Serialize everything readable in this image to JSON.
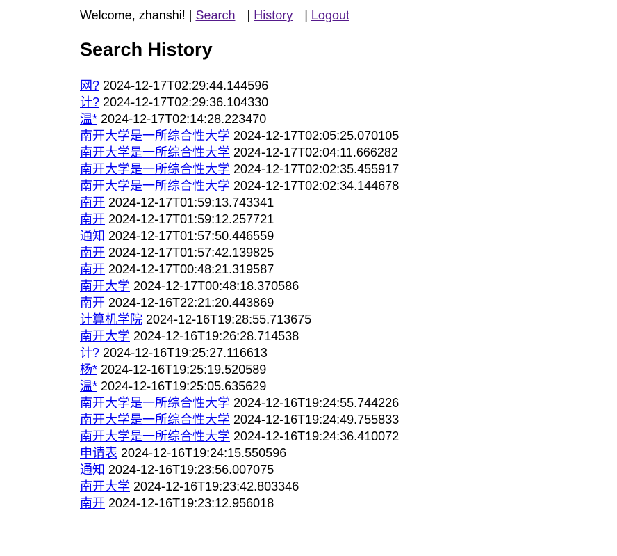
{
  "nav": {
    "welcome": "Welcome, zhanshi!",
    "separator": "|",
    "search_label": "Search",
    "history_label": "History",
    "logout_label": "Logout"
  },
  "page_title": "Search History",
  "history": [
    {
      "query": "网?",
      "timestamp": "2024-12-17T02:29:44.144596"
    },
    {
      "query": "计?",
      "timestamp": "2024-12-17T02:29:36.104330"
    },
    {
      "query": "温*",
      "timestamp": "2024-12-17T02:14:28.223470"
    },
    {
      "query": "南开大学是一所综合性大学",
      "timestamp": "2024-12-17T02:05:25.070105"
    },
    {
      "query": "南开大学是一所综合性大学",
      "timestamp": "2024-12-17T02:04:11.666282"
    },
    {
      "query": "南开大学是一所综合性大学",
      "timestamp": "2024-12-17T02:02:35.455917"
    },
    {
      "query": "南开大学是一所综合性大学",
      "timestamp": "2024-12-17T02:02:34.144678"
    },
    {
      "query": "南开",
      "timestamp": "2024-12-17T01:59:13.743341"
    },
    {
      "query": "南开",
      "timestamp": "2024-12-17T01:59:12.257721"
    },
    {
      "query": "通知",
      "timestamp": "2024-12-17T01:57:50.446559"
    },
    {
      "query": "南开",
      "timestamp": "2024-12-17T01:57:42.139825"
    },
    {
      "query": "南开",
      "timestamp": "2024-12-17T00:48:21.319587"
    },
    {
      "query": "南开大学",
      "timestamp": "2024-12-17T00:48:18.370586"
    },
    {
      "query": "南开",
      "timestamp": "2024-12-16T22:21:20.443869"
    },
    {
      "query": "计算机学院",
      "timestamp": "2024-12-16T19:28:55.713675"
    },
    {
      "query": "南开大学",
      "timestamp": "2024-12-16T19:26:28.714538"
    },
    {
      "query": "计?",
      "timestamp": "2024-12-16T19:25:27.116613"
    },
    {
      "query": "杨*",
      "timestamp": "2024-12-16T19:25:19.520589"
    },
    {
      "query": "温*",
      "timestamp": "2024-12-16T19:25:05.635629"
    },
    {
      "query": "南开大学是一所综合性大学",
      "timestamp": "2024-12-16T19:24:55.744226"
    },
    {
      "query": "南开大学是一所综合性大学",
      "timestamp": "2024-12-16T19:24:49.755833"
    },
    {
      "query": "南开大学是一所综合性大学",
      "timestamp": "2024-12-16T19:24:36.410072"
    },
    {
      "query": "申请表",
      "timestamp": "2024-12-16T19:24:15.550596"
    },
    {
      "query": "通知",
      "timestamp": "2024-12-16T19:23:56.007075"
    },
    {
      "query": "南开大学",
      "timestamp": "2024-12-16T19:23:42.803346"
    },
    {
      "query": "南开",
      "timestamp": "2024-12-16T19:23:12.956018"
    }
  ]
}
